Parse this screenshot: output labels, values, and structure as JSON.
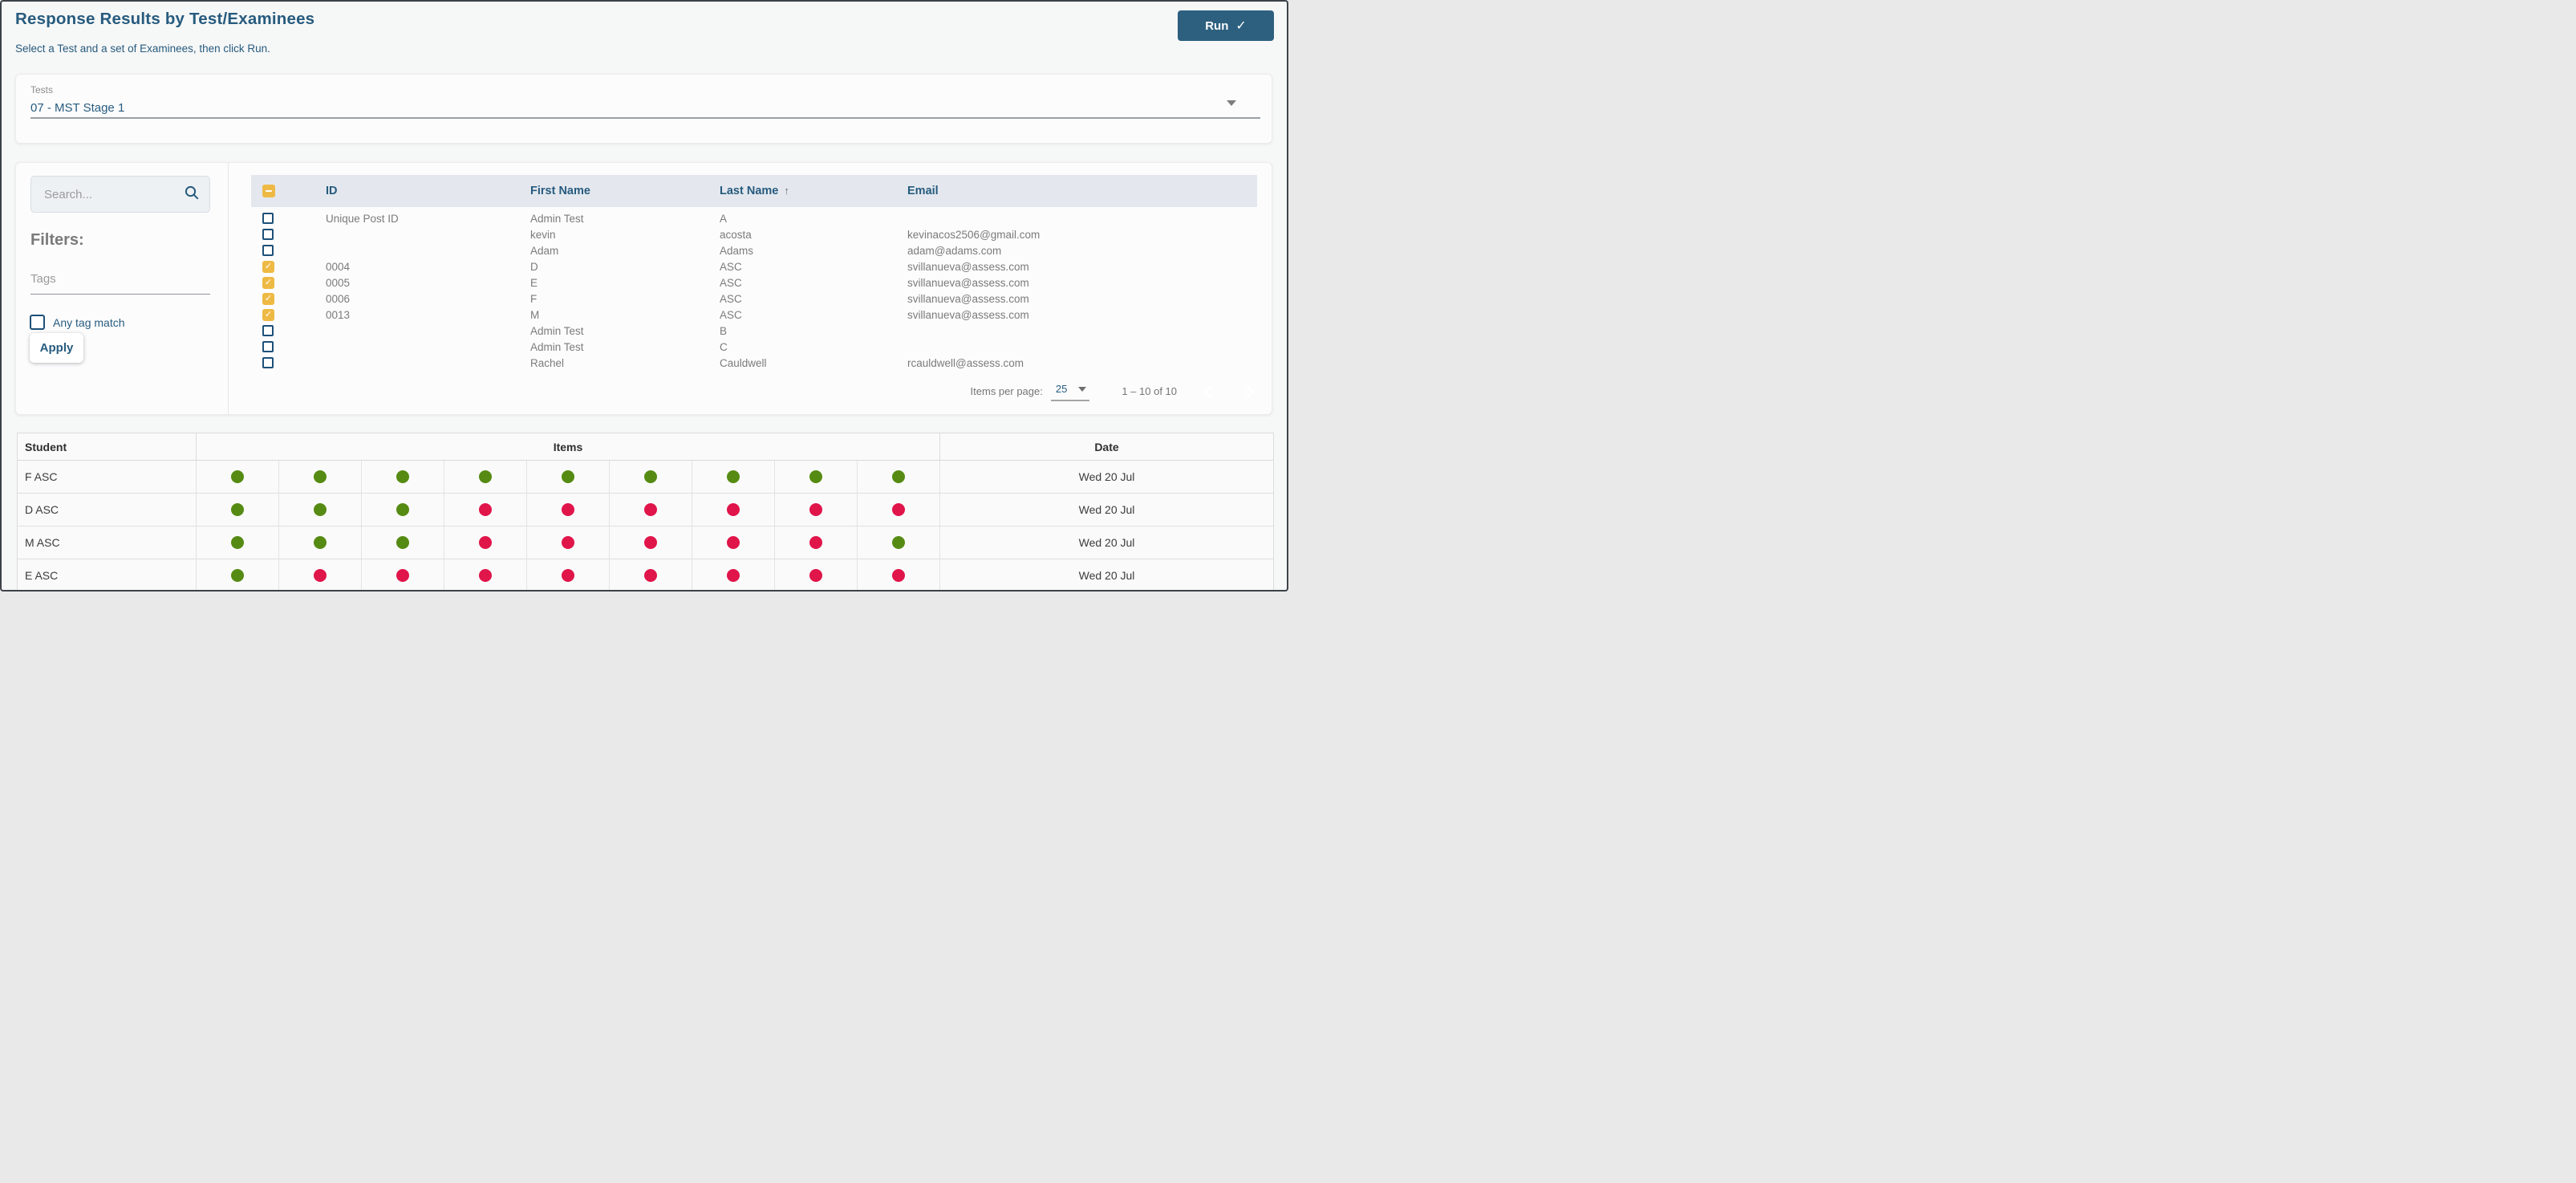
{
  "page": {
    "title": "Response Results by Test/Examinees",
    "subtitle": "Select a Test and a set of Examinees, then click Run.",
    "run_label": "Run"
  },
  "tests_select": {
    "label": "Tests",
    "value": "07 - MST Stage 1"
  },
  "filters": {
    "search_placeholder": "Search...",
    "heading": "Filters:",
    "tags_placeholder": "Tags",
    "any_tag_match_label": "Any tag match",
    "apply_label": "Apply"
  },
  "examinees_table": {
    "header_checkbox_state": "indeterminate",
    "columns": [
      "ID",
      "First Name",
      "Last Name",
      "Email"
    ],
    "sort_column": "Last Name",
    "sort_direction": "ascending",
    "rows": [
      {
        "checked": false,
        "id": "Unique Post ID",
        "first_name": "Admin Test",
        "last_name": "A",
        "email": ""
      },
      {
        "checked": false,
        "id": "",
        "first_name": "kevin",
        "last_name": "acosta",
        "email": "kevinacos2506@gmail.com"
      },
      {
        "checked": false,
        "id": "",
        "first_name": "Adam",
        "last_name": "Adams",
        "email": "adam@adams.com"
      },
      {
        "checked": true,
        "id": "0004",
        "first_name": "D",
        "last_name": "ASC",
        "email": "svillanueva@assess.com"
      },
      {
        "checked": true,
        "id": "0005",
        "first_name": "E",
        "last_name": "ASC",
        "email": "svillanueva@assess.com"
      },
      {
        "checked": true,
        "id": "0006",
        "first_name": "F",
        "last_name": "ASC",
        "email": "svillanueva@assess.com"
      },
      {
        "checked": true,
        "id": "0013",
        "first_name": "M",
        "last_name": "ASC",
        "email": "svillanueva@assess.com"
      },
      {
        "checked": false,
        "id": "",
        "first_name": "Admin Test",
        "last_name": "B",
        "email": ""
      },
      {
        "checked": false,
        "id": "",
        "first_name": "Admin Test",
        "last_name": "C",
        "email": ""
      },
      {
        "checked": false,
        "id": "",
        "first_name": "Rachel",
        "last_name": "Cauldwell",
        "email": "rcauldwell@assess.com"
      }
    ],
    "pagination": {
      "items_per_page_label": "Items per page:",
      "items_per_page": "25",
      "range_label": "1 – 10 of 10"
    }
  },
  "results_table": {
    "columns": [
      "Student",
      "Items",
      "Date"
    ],
    "rows": [
      {
        "student": "F ASC",
        "items": [
          "correct",
          "correct",
          "correct",
          "correct",
          "correct",
          "correct",
          "correct",
          "correct",
          "correct"
        ],
        "date": "Wed 20 Jul"
      },
      {
        "student": "D ASC",
        "items": [
          "correct",
          "correct",
          "correct",
          "incorrect",
          "incorrect",
          "incorrect",
          "incorrect",
          "incorrect",
          "incorrect"
        ],
        "date": "Wed 20 Jul"
      },
      {
        "student": "M ASC",
        "items": [
          "correct",
          "correct",
          "correct",
          "incorrect",
          "incorrect",
          "incorrect",
          "incorrect",
          "incorrect",
          "correct"
        ],
        "date": "Wed 20 Jul"
      },
      {
        "student": "E ASC",
        "items": [
          "correct",
          "incorrect",
          "incorrect",
          "incorrect",
          "incorrect",
          "incorrect",
          "incorrect",
          "incorrect",
          "incorrect"
        ],
        "date": "Wed 20 Jul"
      }
    ]
  },
  "icons": {
    "run_check": "✓",
    "row_check": "✓",
    "sort_asc": "↑"
  },
  "colors": {
    "accent_button": "#2d607f",
    "heading_text": "#275b7e",
    "checkbox_selected": "#eeba45",
    "checkbox_unselected_border": "#1d5078",
    "examinees_header_bg": "#e4e8ee",
    "correct": "#568b13",
    "incorrect": "#e0154a"
  }
}
